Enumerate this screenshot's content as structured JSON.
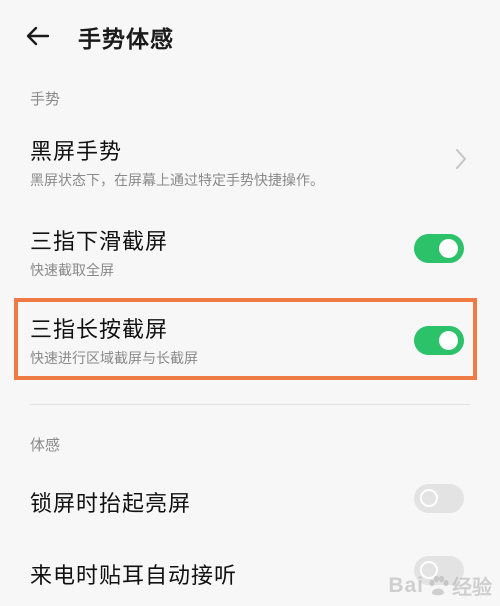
{
  "header": {
    "back_icon": "arrow-left-icon",
    "title": "手势体感"
  },
  "sections": [
    {
      "label": "手势",
      "items": [
        {
          "title": "黑屏手势",
          "subtitle": "黑屏状态下，在屏幕上通过特定手势快捷操作。",
          "control": "chevron"
        },
        {
          "title": "三指下滑截屏",
          "subtitle": "快速截取全屏",
          "control": "toggle",
          "state": "on"
        },
        {
          "title": "三指长按截屏",
          "subtitle": "快速进行区域截屏与长截屏",
          "control": "toggle",
          "state": "on",
          "highlighted": true
        }
      ]
    },
    {
      "label": "体感",
      "items": [
        {
          "title": "锁屏时抬起亮屏",
          "control": "toggle",
          "state": "off"
        },
        {
          "title": "来电时贴耳自动接听",
          "control": "toggle",
          "state": "off"
        }
      ]
    }
  ],
  "colors": {
    "toggle_on": "#2bc26a",
    "toggle_off": "#e3e3e3",
    "highlight": "#f07a43"
  },
  "watermark": {
    "prefix": "Bai",
    "suffix": "经验"
  }
}
